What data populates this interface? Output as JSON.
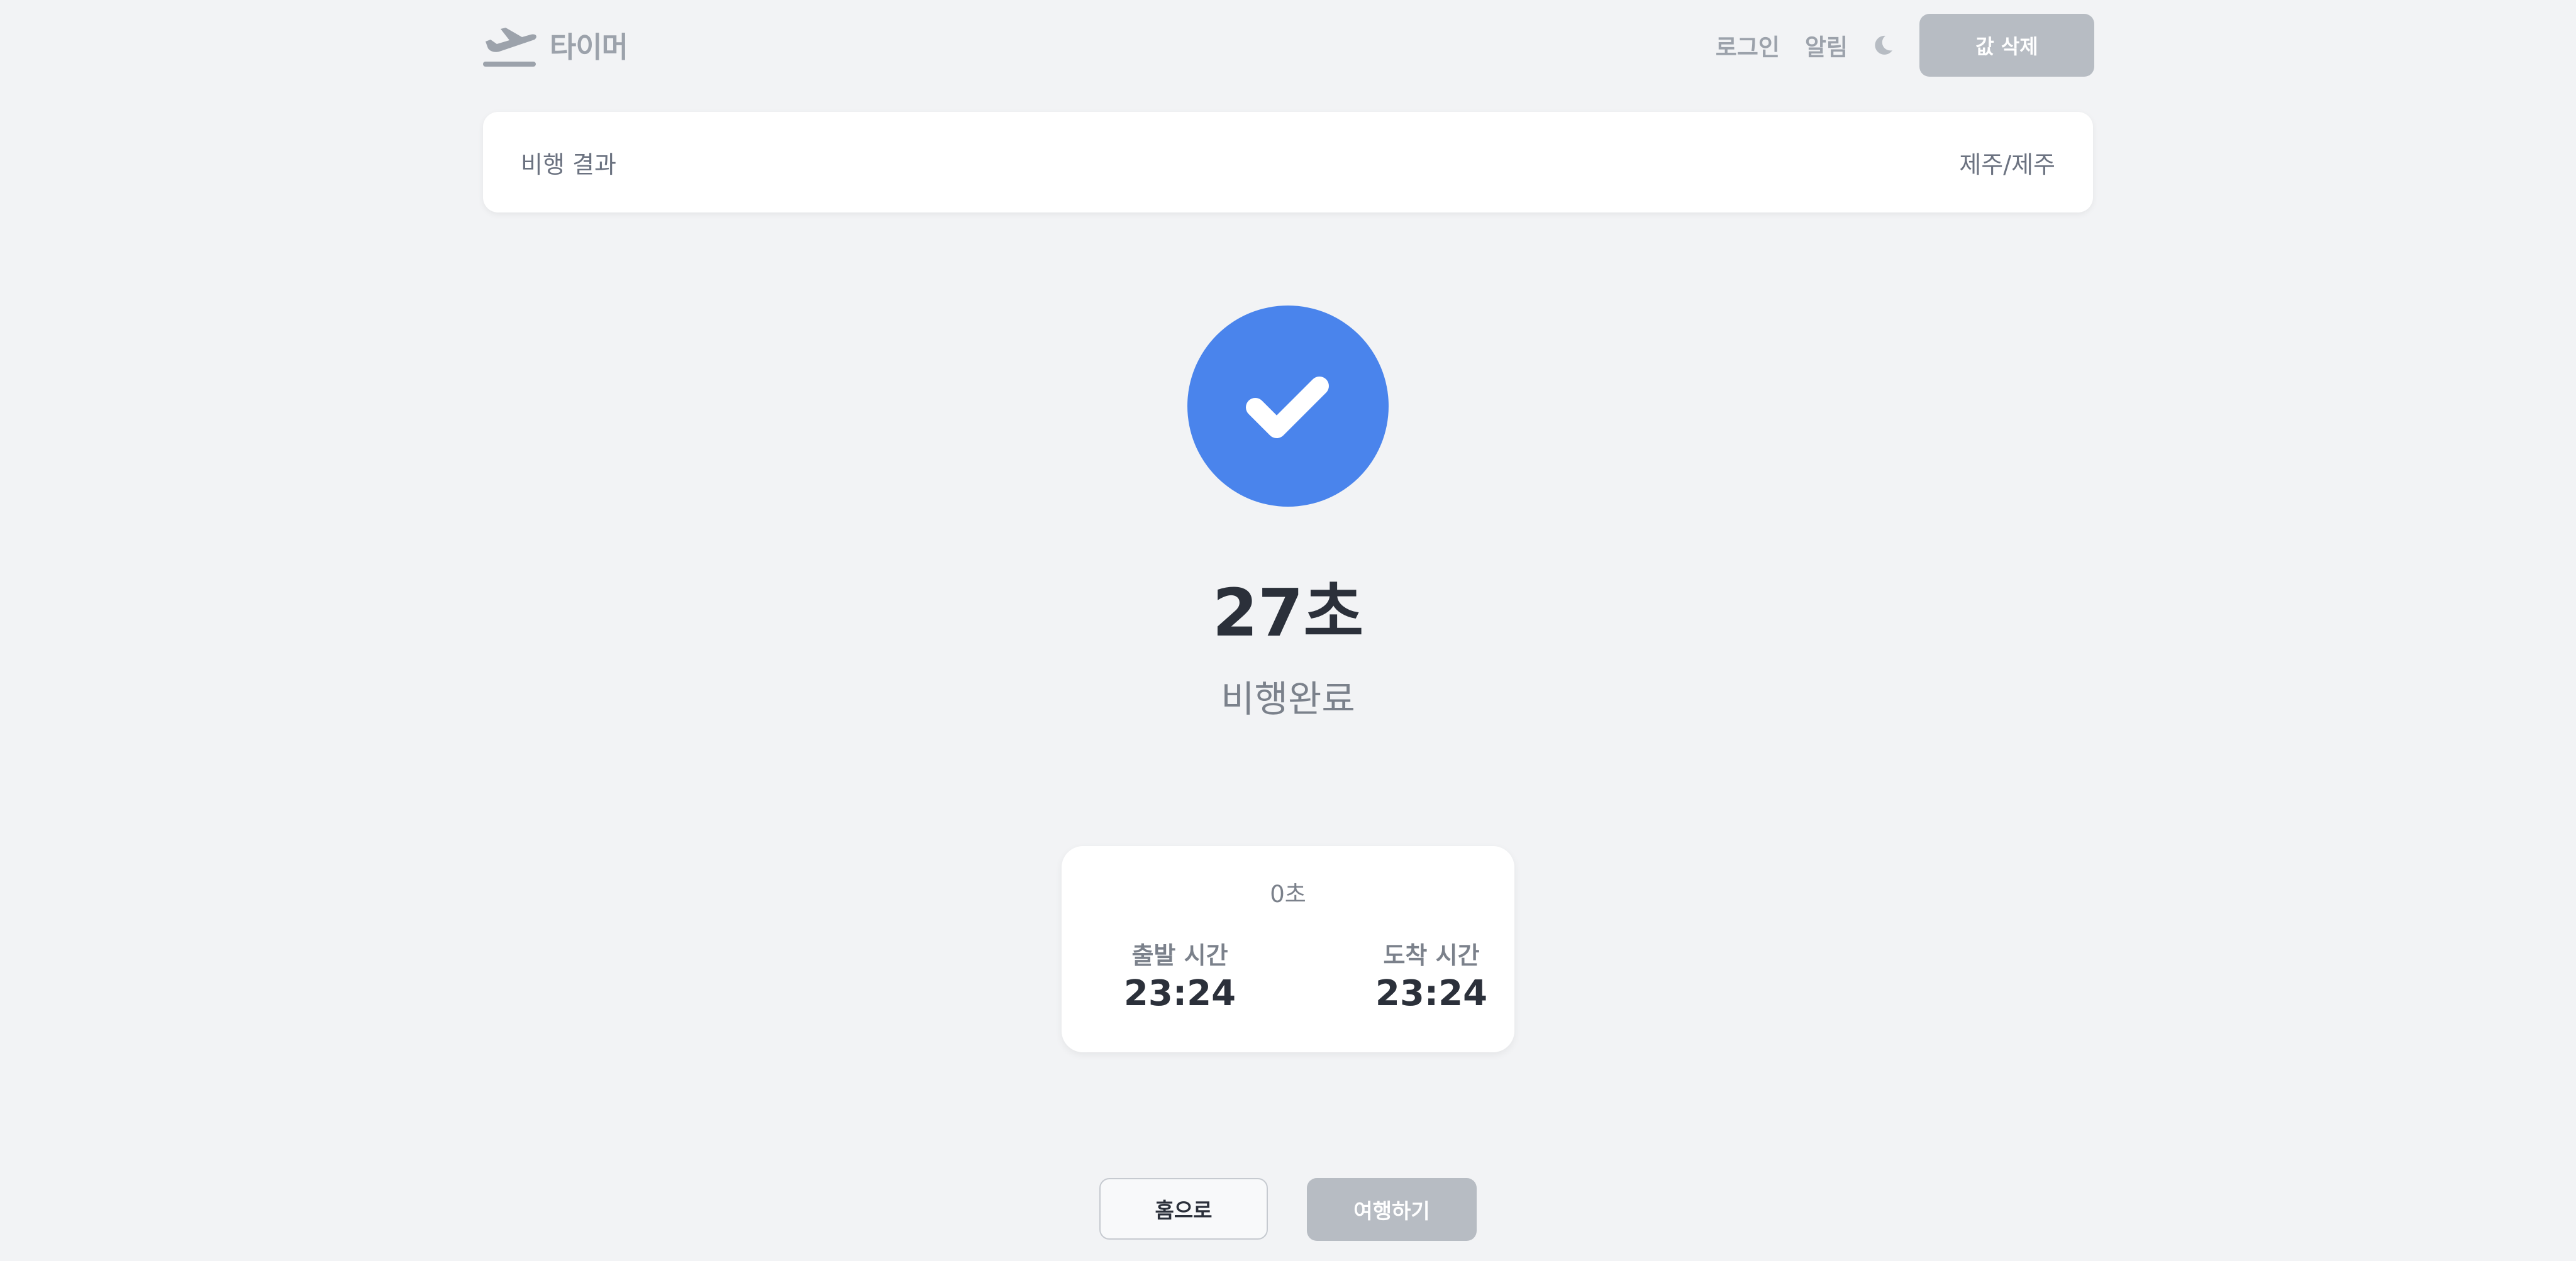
{
  "header": {
    "logo_text": "타이머",
    "login_label": "로그인",
    "alarm_label": "알림",
    "delete_label": "값 삭제"
  },
  "result": {
    "title": "비행 결과",
    "route": "제주/제주"
  },
  "summary": {
    "time": "27초",
    "status": "비행완료"
  },
  "card": {
    "duration": "0초",
    "departure_label": "출발 시간",
    "departure_time": "23:24",
    "arrival_label": "도착 시간",
    "arrival_time": "23:24"
  },
  "actions": {
    "home_label": "홈으로",
    "travel_label": "여행하기"
  },
  "icons": {
    "logo": "airplane-takeoff-icon",
    "theme": "moon-icon",
    "status": "check-icon"
  },
  "colors": {
    "accent": "#4a84ec",
    "background": "#f2f3f5",
    "muted_button": "#b7bcc3",
    "muted_text": "#9ca2ab",
    "dark_text": "#2b303a"
  }
}
